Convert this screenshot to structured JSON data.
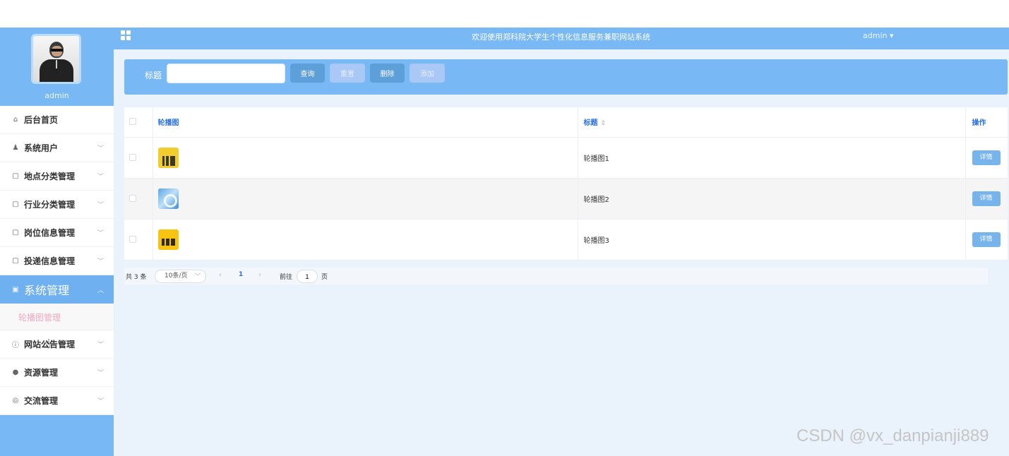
{
  "header": {
    "site_title": "欢迎使用郑科院大学生个性化信息服务兼职网站系统",
    "user_menu_label": "admin ▾"
  },
  "profile": {
    "name": "admin"
  },
  "sidebar": {
    "items": [
      {
        "label": "后台首页",
        "icon": "home-icon"
      },
      {
        "label": "系统用户",
        "icon": "user-icon"
      },
      {
        "label": "地点分类管理",
        "icon": "folder-icon"
      },
      {
        "label": "行业分类管理",
        "icon": "folder-icon"
      },
      {
        "label": "岗位信息管理",
        "icon": "folder-icon"
      },
      {
        "label": "投递信息管理",
        "icon": "folder-icon"
      },
      {
        "label": "系统管理",
        "icon": "image-icon",
        "active": true
      },
      {
        "label": "网站公告管理",
        "icon": "info-icon"
      },
      {
        "label": "资源管理",
        "icon": "pin-icon"
      },
      {
        "label": "交流管理",
        "icon": "chat-icon"
      }
    ],
    "submenu": {
      "label": "轮播图管理"
    }
  },
  "search": {
    "label": "标题",
    "placeholder": "",
    "value": "",
    "buttons": {
      "query": "查询",
      "reset": "重置",
      "delete": "删除",
      "add": "添加"
    }
  },
  "table": {
    "headers": {
      "image": "轮播图",
      "title": "标题",
      "action": "操作"
    },
    "rows": [
      {
        "title": "轮播图1",
        "action": "详情",
        "thumb": "yellow-skyline-thumbnail"
      },
      {
        "title": "轮播图2",
        "action": "详情",
        "thumb": "blue-globe-thumbnail"
      },
      {
        "title": "轮播图3",
        "action": "详情",
        "thumb": "yellow-city-thumbnail"
      }
    ]
  },
  "pagination": {
    "total": "共 3 条",
    "page_size": "10条/页",
    "current_page": "1",
    "goto_label": "前往",
    "goto_value": "1",
    "page_suffix": "页"
  },
  "watermark": "CSDN @vx_danpianji889",
  "colors": {
    "primary": "#77b8f5",
    "button_dark": "#5d9fd9",
    "button_light": "#a9c8f5",
    "submenu_text": "#f4a6c2",
    "header_text": "#2a6fe0"
  }
}
